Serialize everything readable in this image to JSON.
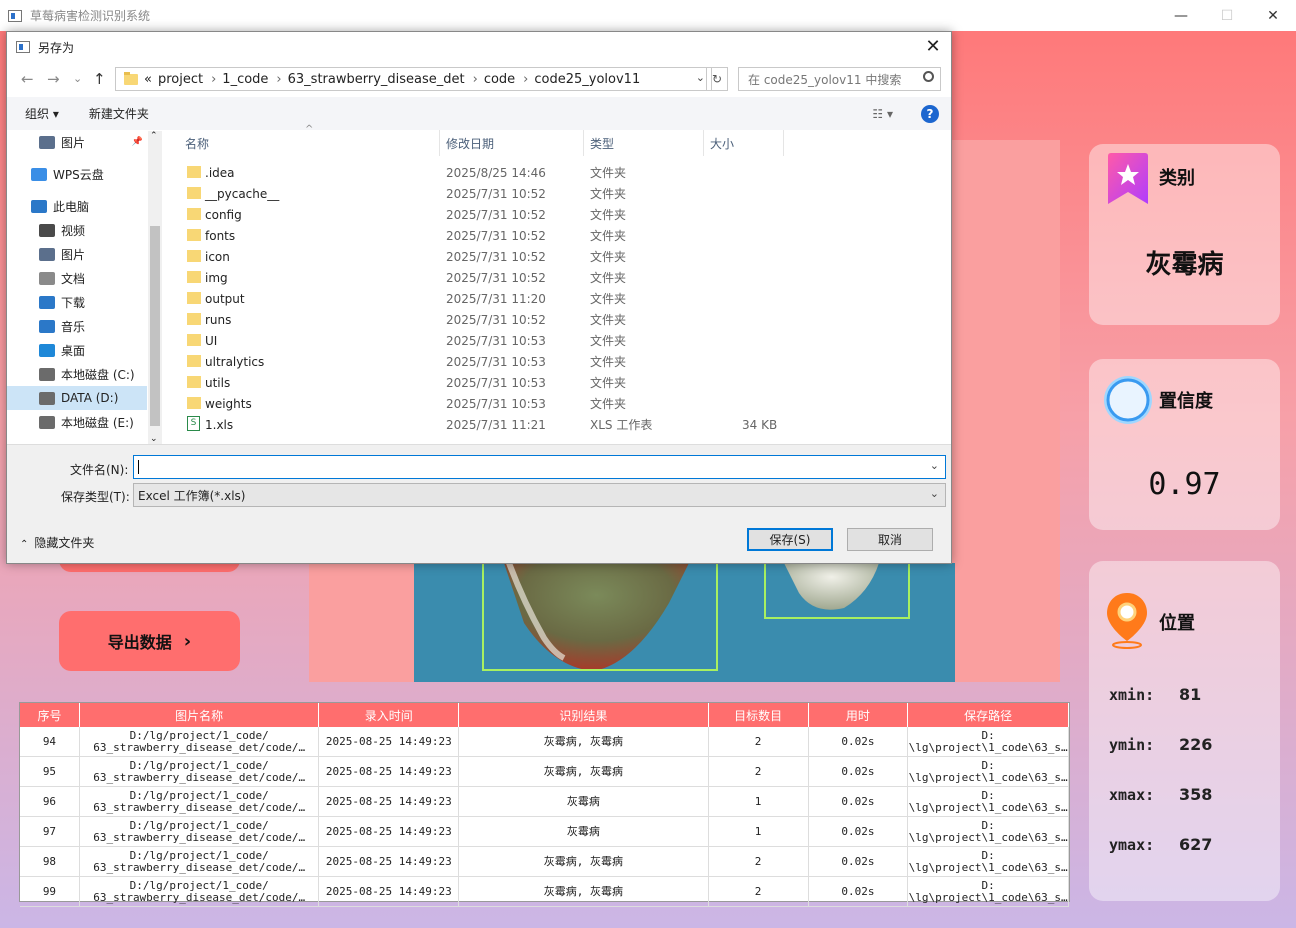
{
  "app": {
    "title": "草莓病害检测识别系统",
    "minimize": "—",
    "maximize": "☐",
    "close": "✕"
  },
  "cards": {
    "category": {
      "title": "类别",
      "value": "灰霉病"
    },
    "confidence": {
      "title": "置信度",
      "value": "0.97"
    },
    "position": {
      "title": "位置",
      "xmin_label": "xmin:",
      "xmin": "81",
      "ymin_label": "ymin:",
      "ymin": "226",
      "xmax_label": "xmax:",
      "xmax": "358",
      "ymax_label": "ymax:",
      "ymax": "627"
    }
  },
  "buttons": {
    "export": "导出数据",
    "export_arrow": "›"
  },
  "table": {
    "headers": [
      "序号",
      "图片名称",
      "录入时间",
      "识别结果",
      "目标数目",
      "用时",
      "保存路径"
    ],
    "rows": [
      [
        "94",
        "D:/lg/project/1_code/\n63_strawberry_disease_det/code/…",
        "2025-08-25 14:49:23",
        "灰霉病, 灰霉病",
        "2",
        "0.02s",
        "D:\n\\lg\\project\\1_code\\63_s…"
      ],
      [
        "95",
        "D:/lg/project/1_code/\n63_strawberry_disease_det/code/…",
        "2025-08-25 14:49:23",
        "灰霉病, 灰霉病",
        "2",
        "0.02s",
        "D:\n\\lg\\project\\1_code\\63_s…"
      ],
      [
        "96",
        "D:/lg/project/1_code/\n63_strawberry_disease_det/code/…",
        "2025-08-25 14:49:23",
        "灰霉病",
        "1",
        "0.02s",
        "D:\n\\lg\\project\\1_code\\63_s…"
      ],
      [
        "97",
        "D:/lg/project/1_code/\n63_strawberry_disease_det/code/…",
        "2025-08-25 14:49:23",
        "灰霉病",
        "1",
        "0.02s",
        "D:\n\\lg\\project\\1_code\\63_s…"
      ],
      [
        "98",
        "D:/lg/project/1_code/\n63_strawberry_disease_det/code/…",
        "2025-08-25 14:49:23",
        "灰霉病, 灰霉病",
        "2",
        "0.02s",
        "D:\n\\lg\\project\\1_code\\63_s…"
      ],
      [
        "99",
        "D:/lg/project/1_code/\n63_strawberry_disease_det/code/…",
        "2025-08-25 14:49:23",
        "灰霉病, 灰霉病",
        "2",
        "0.02s",
        "D:\n\\lg\\project\\1_code\\63_s…"
      ]
    ],
    "partial_top": [
      "94",
      "D:/lg/project/1_code/",
      "",
      "",
      "",
      "",
      ""
    ]
  },
  "dialog": {
    "title": "另存为",
    "close": "✕",
    "nav": {
      "back": "←",
      "forward": "→",
      "recent": "⌄",
      "up": "↑"
    },
    "breadcrumb": [
      "«",
      "project",
      "1_code",
      "63_strawberry_disease_det",
      "code",
      "code25_yolov11"
    ],
    "breadcrumb_sep": "›",
    "search_placeholder": "在 code25_yolov11 中搜索",
    "toolbar": {
      "organize": "组织 ▾",
      "new_folder": "新建文件夹",
      "help": "?",
      "view": "☷ ▾"
    },
    "sidebar": [
      {
        "label": "图片",
        "color": "#5b6f8c",
        "pin": "📌"
      },
      {
        "label": "WPS云盘",
        "color": "#3a8ee6"
      },
      {
        "label": "此电脑",
        "color": "#2b78c8"
      },
      {
        "label": "视频",
        "color": "#4a4a4a"
      },
      {
        "label": "图片",
        "color": "#5b6f8c"
      },
      {
        "label": "文档",
        "color": "#8a8a8a"
      },
      {
        "label": "下载",
        "color": "#2b78c8"
      },
      {
        "label": "音乐",
        "color": "#2b78c8"
      },
      {
        "label": "桌面",
        "color": "#1e88d8"
      },
      {
        "label": "本地磁盘 (C:)",
        "color": "#6b6b6b"
      },
      {
        "label": "DATA (D:)",
        "color": "#6b6b6b"
      },
      {
        "label": "本地磁盘 (E:)",
        "color": "#6b6b6b"
      }
    ],
    "columns": {
      "name": "名称",
      "date": "修改日期",
      "type": "类型",
      "size": "大小"
    },
    "files": [
      {
        "name": ".idea",
        "date": "2025/8/25 14:46",
        "type": "文件夹",
        "size": ""
      },
      {
        "name": "__pycache__",
        "date": "2025/7/31 10:52",
        "type": "文件夹",
        "size": ""
      },
      {
        "name": "config",
        "date": "2025/7/31 10:52",
        "type": "文件夹",
        "size": ""
      },
      {
        "name": "fonts",
        "date": "2025/7/31 10:52",
        "type": "文件夹",
        "size": ""
      },
      {
        "name": "icon",
        "date": "2025/7/31 10:52",
        "type": "文件夹",
        "size": ""
      },
      {
        "name": "img",
        "date": "2025/7/31 10:52",
        "type": "文件夹",
        "size": ""
      },
      {
        "name": "output",
        "date": "2025/7/31 11:20",
        "type": "文件夹",
        "size": ""
      },
      {
        "name": "runs",
        "date": "2025/7/31 10:52",
        "type": "文件夹",
        "size": ""
      },
      {
        "name": "UI",
        "date": "2025/7/31 10:53",
        "type": "文件夹",
        "size": ""
      },
      {
        "name": "ultralytics",
        "date": "2025/7/31 10:53",
        "type": "文件夹",
        "size": ""
      },
      {
        "name": "utils",
        "date": "2025/7/31 10:53",
        "type": "文件夹",
        "size": ""
      },
      {
        "name": "weights",
        "date": "2025/7/31 10:53",
        "type": "文件夹",
        "size": ""
      },
      {
        "name": "1.xls",
        "date": "2025/7/31 11:21",
        "type": "XLS 工作表",
        "size": "34 KB"
      }
    ],
    "filename_label": "文件名(N):",
    "filename_value": "",
    "filetype_label": "保存类型(T):",
    "filetype_value": "Excel 工作簿(*.xls)",
    "hide_folders": "隐藏文件夹",
    "save": "保存(S)",
    "cancel": "取消"
  }
}
